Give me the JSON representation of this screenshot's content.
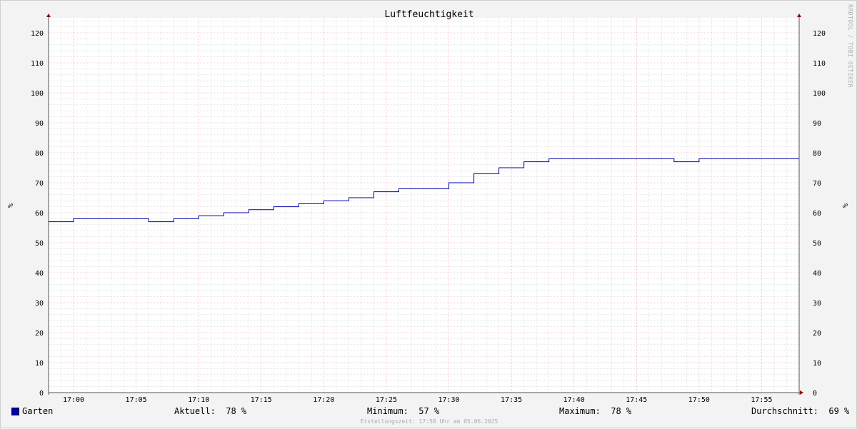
{
  "chart_data": {
    "type": "line",
    "title": "Luftfeuchtigkeit",
    "ylabel": "%",
    "ylabel_right": "%",
    "ylim": [
      0,
      125
    ],
    "yticks": [
      0,
      10,
      20,
      30,
      40,
      50,
      60,
      70,
      80,
      90,
      100,
      110,
      120
    ],
    "xlim_minutes": [
      58,
      118
    ],
    "xticks": [
      {
        "label": "17:00",
        "minute": 60
      },
      {
        "label": "17:05",
        "minute": 65
      },
      {
        "label": "17:10",
        "minute": 70
      },
      {
        "label": "17:15",
        "minute": 75
      },
      {
        "label": "17:20",
        "minute": 80
      },
      {
        "label": "17:25",
        "minute": 85
      },
      {
        "label": "17:30",
        "minute": 90
      },
      {
        "label": "17:35",
        "minute": 95
      },
      {
        "label": "17:40",
        "minute": 100
      },
      {
        "label": "17:45",
        "minute": 105
      },
      {
        "label": "17:50",
        "minute": 110
      },
      {
        "label": "17:55",
        "minute": 115
      }
    ],
    "grid": true,
    "legend_position": "bottom-left",
    "series": [
      {
        "name": "Garten",
        "color": "#0000aa",
        "x": [
          58,
          60,
          66,
          68,
          70,
          72,
          74,
          76,
          78,
          80,
          82,
          84,
          86,
          90,
          92,
          94,
          96,
          98,
          108,
          110,
          118
        ],
        "y": [
          57,
          58,
          57,
          58,
          59,
          60,
          61,
          62,
          63,
          64,
          65,
          67,
          68,
          70,
          73,
          75,
          77,
          78,
          77,
          78,
          78
        ]
      }
    ]
  },
  "colors": {
    "major_grid": "#f3a6b0",
    "minor_grid": "#cccccc",
    "axis": "#555555",
    "arrow": "#8b0000",
    "line": "#0000aa"
  },
  "legend": {
    "series_name": "Garten",
    "current": "Aktuell:  78 %",
    "minimum": "Minimum:  57 %",
    "maximum": "Maximum:  78 %",
    "average": "Durchschnitt:  69 %"
  },
  "footer": "Erstellungszeit: 17:58 Uhr am 05.06.2025",
  "watermark": "RRDTOOL / TOBI OETIKER"
}
